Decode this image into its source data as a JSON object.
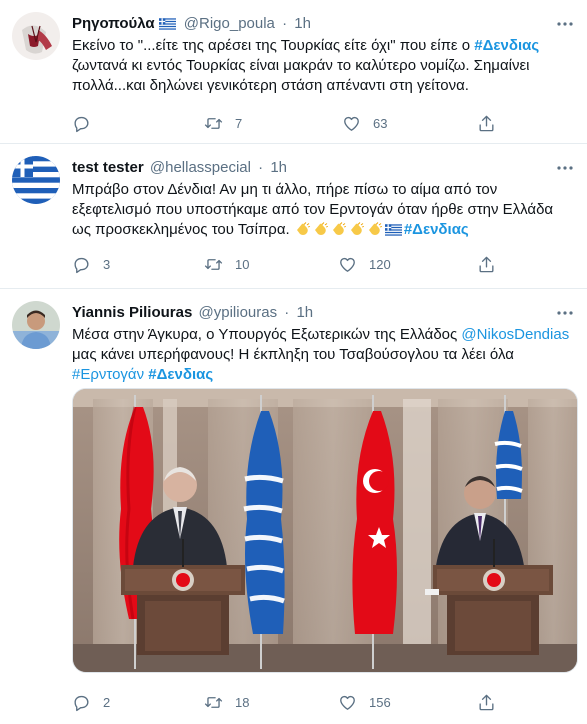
{
  "tweets": [
    {
      "name": "Ρηγοπούλα",
      "handle": "@Rigo_poula",
      "dot": "·",
      "time": "1h",
      "text_1": "Εκείνο το \"...είτε της αρέσει της Τουρκίας είτε όχι\" που είπε ο ",
      "hashtag": "#Δενδιας",
      "text_2": " ζωντανά κι εντός Τουρκίας είναι μακράν το καλύτερο  νομίζω. Σημαίνει πολλά...και δηλώνει γενικότερη στάση απέναντι στη γείτονα.",
      "replies": "",
      "retweets": "7",
      "likes": "63"
    },
    {
      "name": "test tester",
      "handle": "@hellasspecial",
      "dot": "·",
      "time": "1h",
      "text_1": "Μπράβο στον Δένδια! Αν μη τι άλλο, πήρε πίσω το αίμα από τον εξεφτελισμό που υποστήκαμε από τον Ερντογάν όταν ήρθε στην Ελλάδα ως προσκεκλημένος του Τσίπρα. ",
      "hashtag": "#Δενδιας",
      "replies": "3",
      "retweets": "10",
      "likes": "120"
    },
    {
      "name": "Yiannis Piliouras",
      "handle": "@ypiliouras",
      "dot": "·",
      "time": "1h",
      "text_1": "Μέσα στην Άγκυρα, ο Υπουργός Εξωτερικών της Ελλάδος ",
      "mention": "@NikosDendias",
      "text_2": " μας κάνει υπερήφανους! Η έκπληξη του Τσαβούσογλου τα λέει όλα",
      "hashtag_1": "#Ερντογάν",
      "hashtag_2": "#Δενδιας",
      "replies": "2",
      "retweets": "18",
      "likes": "156"
    }
  ],
  "colors": {
    "link": "#1b95e0",
    "secondary_text": "#5b7083",
    "divider": "#e6ecf0",
    "turkey_red": "#e30a17",
    "greece_blue": "#1f5fb8"
  },
  "icons": [
    "reply-icon",
    "retweet-icon",
    "like-icon",
    "share-icon",
    "more-icon",
    "greece-flag-icon",
    "clapping-hands-icon"
  ]
}
